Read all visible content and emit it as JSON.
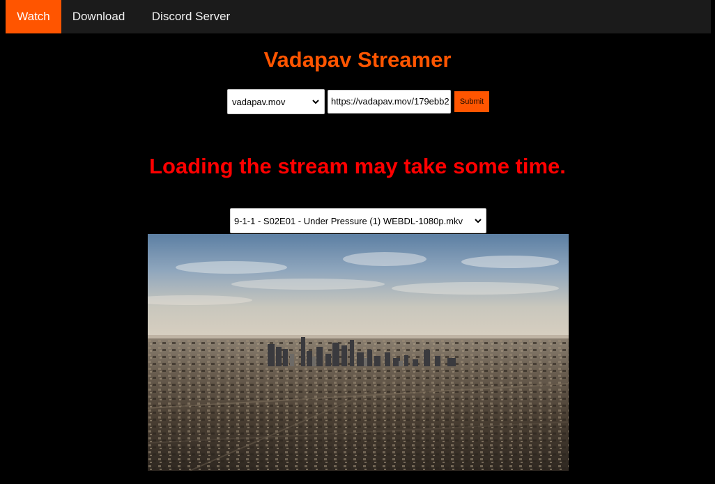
{
  "nav": {
    "items": [
      {
        "label": "Watch",
        "active": true
      },
      {
        "label": "Download",
        "active": false
      },
      {
        "label": "Discord Server",
        "active": false
      }
    ]
  },
  "header": {
    "title": "Vadapav Streamer"
  },
  "form": {
    "source_selected": "vadapav.mov",
    "url_value": "https://vadapav.mov/179ebb2",
    "submit_label": "Submit"
  },
  "notice": "Loading the stream may take some time.",
  "episode": {
    "selected": "9-1-1 - S02E01 - Under Pressure (1) WEBDL-1080p.mkv"
  },
  "video": {
    "content": "aerial-city-skyline-frame"
  },
  "colors": {
    "accent": "#ff5500",
    "notice": "#ff0000",
    "nav_bg": "#1b1b1b",
    "page_bg": "#000000"
  }
}
